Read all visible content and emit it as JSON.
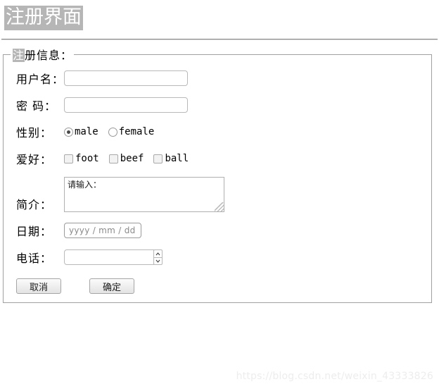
{
  "page": {
    "title": "注册界面",
    "title_selected": true
  },
  "fieldset": {
    "legend_selected_part": "注",
    "legend_rest": "册信息："
  },
  "form": {
    "username": {
      "label": "用户名：",
      "value": "",
      "placeholder": ""
    },
    "password": {
      "label": "密 码：",
      "value": "",
      "placeholder": ""
    },
    "gender": {
      "label": "性别：",
      "options": [
        {
          "label": "male",
          "checked": true
        },
        {
          "label": "female",
          "checked": false
        }
      ]
    },
    "hobby": {
      "label": "爱好：",
      "options": [
        {
          "label": "foot",
          "checked": false
        },
        {
          "label": "beef",
          "checked": false
        },
        {
          "label": "ball",
          "checked": false
        }
      ]
    },
    "intro": {
      "label": "简介：",
      "value": "请输入："
    },
    "date": {
      "label": "日期：",
      "placeholder": "yyyy / mm / dd"
    },
    "phone": {
      "label": "电话：",
      "value": "",
      "spinner_up": "spinner-up-icon",
      "spinner_down": "spinner-down-icon"
    }
  },
  "buttons": {
    "cancel": "取消",
    "confirm": "确定"
  },
  "watermark": "https://blog.csdn.net/weixin_43333826",
  "colors": {
    "selection_bg": "#b6b6b6",
    "selection_fg": "#ffffff",
    "border": "#a0a0a0",
    "input_border": "#b9b9b9",
    "placeholder": "#8a8a8a",
    "watermark": "#ededed"
  }
}
